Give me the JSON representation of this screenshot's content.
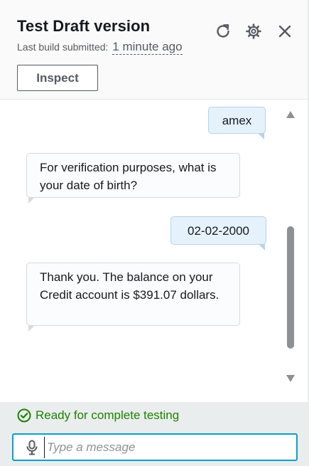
{
  "header": {
    "title": "Test Draft version",
    "build_label": "Last build submitted:",
    "build_time": "1 minute ago",
    "inspect_label": "Inspect",
    "icons": [
      "refresh-icon",
      "settings-gear-icon",
      "close-icon"
    ]
  },
  "chat": {
    "messages": [
      {
        "sender": "user",
        "text": "amex"
      },
      {
        "sender": "bot",
        "text": "For verification purposes, what is your date of birth?"
      },
      {
        "sender": "user",
        "text": "02-02-2000"
      },
      {
        "sender": "bot",
        "text": "Thank you. The balance on your Credit account is $391.07 dollars."
      }
    ]
  },
  "footer": {
    "status_text": "Ready for complete testing",
    "input_placeholder": "Type a message",
    "input_value": ""
  },
  "colors": {
    "status_green": "#1d8102",
    "input_focus": "#0aa0c6",
    "user_bubble": "#e6f2fb",
    "bot_bubble": "#fafcfd"
  }
}
